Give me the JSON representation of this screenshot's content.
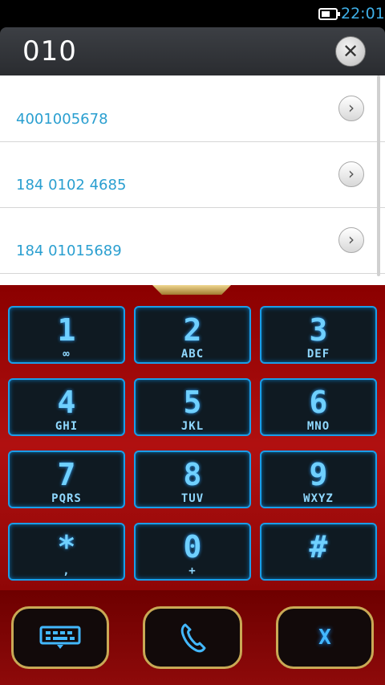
{
  "status_bar": {
    "time": "22:01",
    "battery_level": 0.6
  },
  "search": {
    "query": "010",
    "clear_icon": "close-icon"
  },
  "results": [
    {
      "number": "4001005678"
    },
    {
      "number": "184 0102 4685"
    },
    {
      "number": "184 01015689"
    }
  ],
  "keypad": [
    {
      "digit": "1",
      "letters": "∞"
    },
    {
      "digit": "2",
      "letters": "ABC"
    },
    {
      "digit": "3",
      "letters": "DEF"
    },
    {
      "digit": "4",
      "letters": "GHI"
    },
    {
      "digit": "5",
      "letters": "JKL"
    },
    {
      "digit": "6",
      "letters": "MNO"
    },
    {
      "digit": "7",
      "letters": "PQRS"
    },
    {
      "digit": "8",
      "letters": "TUV"
    },
    {
      "digit": "9",
      "letters": "WXYZ"
    },
    {
      "digit": "*",
      "letters": ","
    },
    {
      "digit": "0",
      "letters": "+"
    },
    {
      "digit": "#",
      "letters": ""
    }
  ],
  "controls": {
    "delete_label": "X"
  },
  "colors": {
    "accent": "#3fb0e8",
    "keypad_glow": "#1a9ee8",
    "frame_red": "#a80b0b",
    "gold": "#c9a955"
  }
}
